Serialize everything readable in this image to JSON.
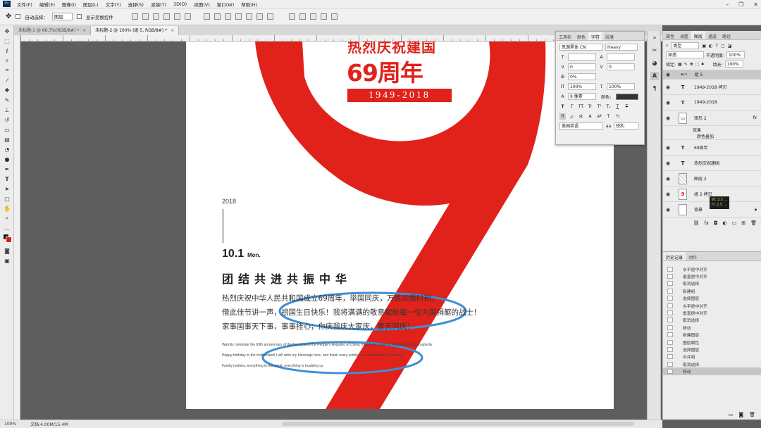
{
  "menu": {
    "items": [
      "文件(F)",
      "编辑(E)",
      "图像(I)",
      "图层(L)",
      "文字(Y)",
      "选择(S)",
      "滤镜(T)",
      "3D(D)",
      "视图(V)",
      "窗口(W)",
      "帮助(H)"
    ]
  },
  "options": {
    "auto_select_label": "自动选择：",
    "auto_select_value": "图层",
    "transform_label": "显示变换控件"
  },
  "tabs": [
    {
      "label": "未标题-1 @ 66.7%(RGB/8#) *"
    },
    {
      "label": "未标题-2 @ 100% (组 5, RGB/8#) *"
    }
  ],
  "poster": {
    "banner_top": "热烈庆祝建国",
    "big_years": "69周年",
    "year_range": "1949-2018",
    "year": "2018",
    "date": "10.1",
    "weekday": "Mon.",
    "slogan": "团结共进共振中华",
    "cn_lines": [
      "热烈庆祝中华人民共和国成立69周年，举国同庆，万民欢腾时刻，",
      "借此佳节讲一声，祖国生日快乐！我将满满的敬意献给每一位为国捐躯的战士！",
      "家事国事天下事，事事挂心；你庆我庆大家庆，普天同庆！"
    ],
    "en_lines": [
      "Warmly celebrate the 69th anniversary of the founding of the People's Republic of China, the whole nation in celebration and prosperity",
      "Happy birthday to the motherland! I will write my blessings here, and thank every soldier who devoted to the country!",
      "Family matters, everything in the world, everything is troubling us"
    ],
    "red": "#e0221b"
  },
  "char_panel": {
    "tabs": [
      "工具栏",
      "颜色",
      "字符",
      "段落"
    ],
    "font_family": "思源黑体 CN",
    "font_style": "Heavy",
    "size": "",
    "leading": "",
    "kerning": "0",
    "tracking": "0",
    "scale_pct": "0%",
    "vscale": "100%",
    "hscale": "100%",
    "baseline": "9 像素",
    "color_label": "颜色：",
    "lang": "美国英语",
    "aa": "锐利"
  },
  "layers_panel": {
    "tabs": [
      "属性",
      "调整",
      "图层",
      "通道",
      "路径"
    ],
    "filter": "类型",
    "blend": "穿透",
    "opacity_label": "不透明度:",
    "opacity": "100%",
    "lock_label": "锁定:",
    "fill_label": "填充:",
    "fill": "100%",
    "layers": [
      {
        "name": "组 5",
        "kind": "group"
      },
      {
        "name": "1949-2018 拷贝",
        "kind": "text"
      },
      {
        "name": "1949-2018",
        "kind": "text"
      },
      {
        "name": "矩形 2",
        "kind": "shape"
      },
      {
        "name": "效果",
        "kind": "fx"
      },
      {
        "name": "颜色叠加",
        "kind": "fx"
      },
      {
        "name": "69周年",
        "kind": "text"
      },
      {
        "name": "热烈庆祝建国",
        "kind": "text"
      },
      {
        "name": "图层 2",
        "kind": "pixel"
      },
      {
        "name": "组 2 拷贝",
        "kind": "group"
      },
      {
        "name": "背景",
        "kind": "background"
      }
    ],
    "tooltip": [
      "W: 3.5 …",
      "H: 2.5 …"
    ]
  },
  "history_panel": {
    "tabs": [
      "历史记录",
      "动作"
    ],
    "items": [
      "水平居中对齐",
      "垂直居中对齐",
      "取消选择",
      "新建组",
      "选择图层",
      "水平居中对齐",
      "垂直居中对齐",
      "取消选择",
      "移动",
      "新建图层",
      "图层属性",
      "选择图层",
      "合并组",
      "取消选择",
      "移动"
    ]
  },
  "status": {
    "zoom": "100%",
    "doc": "文档:4.00M/15.4M"
  }
}
